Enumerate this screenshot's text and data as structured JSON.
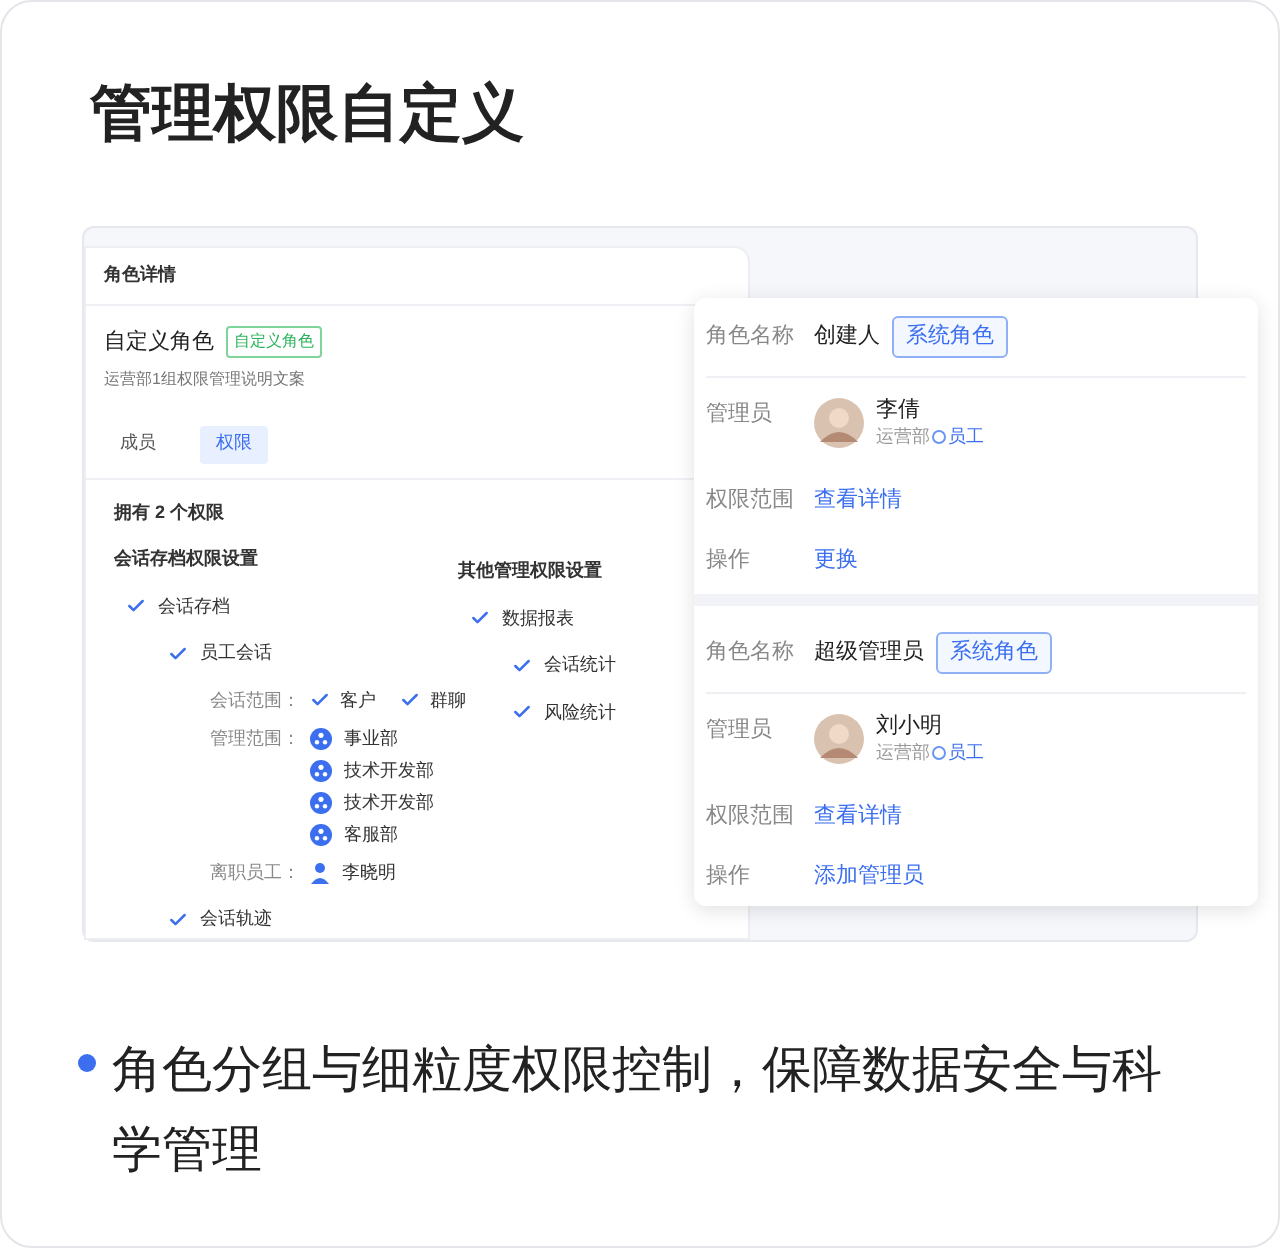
{
  "title": "管理权限自定义",
  "detail": {
    "header": "角色详情",
    "role_name": "自定义角色",
    "role_tag": "自定义角色",
    "description": "运营部1组权限管理说明文案",
    "tabs": [
      {
        "label": "成员",
        "selected": false
      },
      {
        "label": "权限",
        "selected": true
      }
    ],
    "count_text": "拥有 2 个权限",
    "groups": [
      {
        "title": "会话存档权限设置",
        "items": [
          {
            "label": "会话存档",
            "checked": true,
            "children": [
              {
                "label": "员工会话",
                "checked": true,
                "details": [
                  {
                    "label": "会话范围：",
                    "kind": "checks",
                    "values": [
                      {
                        "text": "客户",
                        "checked": true
                      },
                      {
                        "text": "群聊",
                        "checked": true
                      }
                    ]
                  },
                  {
                    "label": "管理范围：",
                    "kind": "departments",
                    "values": [
                      {
                        "text": "事业部"
                      },
                      {
                        "text": "技术开发部"
                      },
                      {
                        "text": "技术开发部"
                      },
                      {
                        "text": "客服部"
                      }
                    ]
                  },
                  {
                    "label": "离职员工：",
                    "kind": "people",
                    "values": [
                      {
                        "text": "李晓明"
                      }
                    ]
                  }
                ]
              },
              {
                "label": "会话轨迹",
                "checked": true
              }
            ]
          }
        ]
      },
      {
        "title": "其他管理权限设置",
        "items": [
          {
            "label": "数据报表",
            "checked": true,
            "children": [
              {
                "label": "会话统计",
                "checked": true
              },
              {
                "label": "风险统计",
                "checked": true
              }
            ]
          }
        ]
      }
    ]
  },
  "roles": [
    {
      "name_label": "角色名称",
      "name": "创建人",
      "tag": "系统角色",
      "admin_label": "管理员",
      "admin_name": "李倩",
      "admin_dept": "运营部",
      "admin_role": "员工",
      "scope_label": "权限范围",
      "scope_link": "查看详情",
      "action_label": "操作",
      "action_link": "更换"
    },
    {
      "name_label": "角色名称",
      "name": "超级管理员",
      "tag": "系统角色",
      "admin_label": "管理员",
      "admin_name": "刘小明",
      "admin_dept": "运营部",
      "admin_role": "员工",
      "scope_label": "权限范围",
      "scope_link": "查看详情",
      "action_label": "操作",
      "action_link": "添加管理员"
    }
  ],
  "bullet": "角色分组与细粒度权限控制，保障数据安全与科学管理"
}
